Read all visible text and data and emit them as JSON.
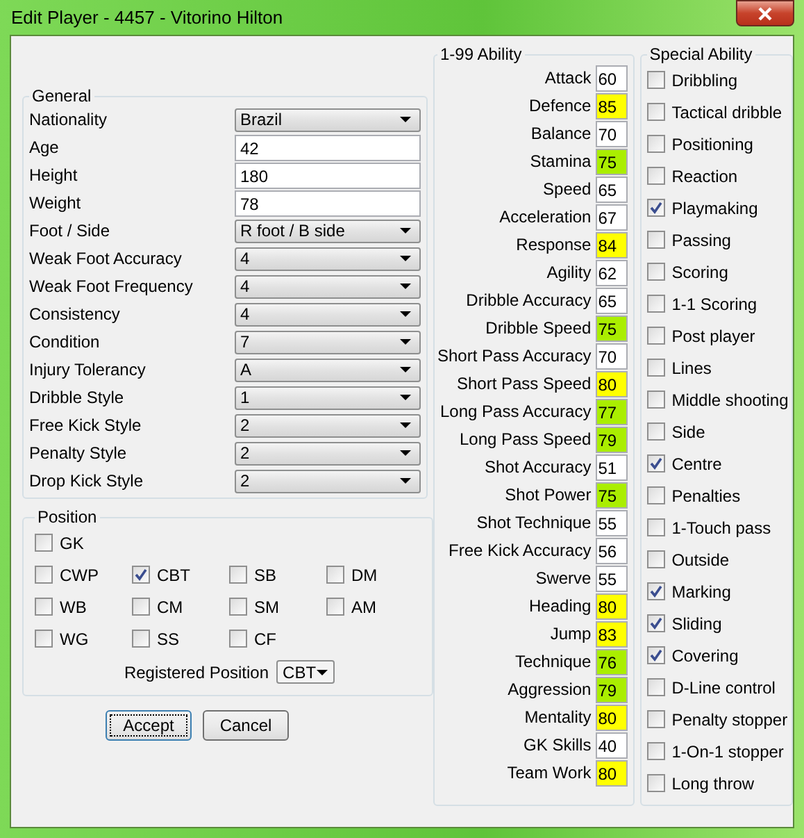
{
  "window": {
    "title": "Edit Player - 4457 - Vitorino Hilton"
  },
  "general": {
    "title": "General",
    "fields": [
      {
        "label": "Nationality",
        "kind": "select",
        "value": "Brazil"
      },
      {
        "label": "Age",
        "kind": "text",
        "value": "42"
      },
      {
        "label": "Height",
        "kind": "text",
        "value": "180"
      },
      {
        "label": "Weight",
        "kind": "text",
        "value": "78"
      },
      {
        "label": "Foot / Side",
        "kind": "select",
        "value": "R foot / B side"
      },
      {
        "label": "Weak Foot Accuracy",
        "kind": "select",
        "value": "4"
      },
      {
        "label": "Weak Foot Frequency",
        "kind": "select",
        "value": "4"
      },
      {
        "label": "Consistency",
        "kind": "select",
        "value": "4"
      },
      {
        "label": "Condition",
        "kind": "select",
        "value": "7"
      },
      {
        "label": "Injury Tolerancy",
        "kind": "select",
        "value": "A"
      },
      {
        "label": "Dribble Style",
        "kind": "select",
        "value": "1"
      },
      {
        "label": "Free Kick Style",
        "kind": "select",
        "value": "2"
      },
      {
        "label": "Penalty Style",
        "kind": "select",
        "value": "2"
      },
      {
        "label": "Drop Kick Style",
        "kind": "select",
        "value": "2"
      }
    ]
  },
  "position": {
    "title": "Position",
    "rows": [
      {
        "items": [
          {
            "label": "GK",
            "checked": false
          }
        ]
      },
      {
        "items": [
          {
            "label": "CWP",
            "checked": false
          },
          {
            "label": "CBT",
            "checked": true
          },
          {
            "label": "SB",
            "checked": false
          },
          {
            "label": "DM",
            "checked": false
          }
        ]
      },
      {
        "items": [
          {
            "label": "WB",
            "checked": false
          },
          {
            "label": "CM",
            "checked": false
          },
          {
            "label": "SM",
            "checked": false
          },
          {
            "label": "AM",
            "checked": false
          }
        ]
      },
      {
        "items": [
          {
            "label": "WG",
            "checked": false
          },
          {
            "label": "SS",
            "checked": false
          },
          {
            "label": "CF",
            "checked": false
          }
        ]
      }
    ],
    "registered_label": "Registered Position",
    "registered_value": "CBT"
  },
  "buttons": [
    {
      "label": "Accept",
      "focused": true
    },
    {
      "label": "Cancel",
      "focused": false
    }
  ],
  "abilities": {
    "title": "1-99 Ability",
    "items": [
      {
        "label": "Attack",
        "value": "60",
        "color": "#ffffff"
      },
      {
        "label": "Defence",
        "value": "85",
        "color": "#ffff00"
      },
      {
        "label": "Balance",
        "value": "70",
        "color": "#ffffff"
      },
      {
        "label": "Stamina",
        "value": "75",
        "color": "#aaee00"
      },
      {
        "label": "Speed",
        "value": "65",
        "color": "#ffffff"
      },
      {
        "label": "Acceleration",
        "value": "67",
        "color": "#ffffff"
      },
      {
        "label": "Response",
        "value": "84",
        "color": "#ffff00"
      },
      {
        "label": "Agility",
        "value": "62",
        "color": "#ffffff"
      },
      {
        "label": "Dribble Accuracy",
        "value": "65",
        "color": "#ffffff"
      },
      {
        "label": "Dribble Speed",
        "value": "75",
        "color": "#aaee00"
      },
      {
        "label": "Short Pass Accuracy",
        "value": "70",
        "color": "#ffffff"
      },
      {
        "label": "Short Pass Speed",
        "value": "80",
        "color": "#ffff00"
      },
      {
        "label": "Long Pass Accuracy",
        "value": "77",
        "color": "#aaee00"
      },
      {
        "label": "Long Pass Speed",
        "value": "79",
        "color": "#aaee00"
      },
      {
        "label": "Shot Accuracy",
        "value": "51",
        "color": "#ffffff"
      },
      {
        "label": "Shot Power",
        "value": "75",
        "color": "#aaee00"
      },
      {
        "label": "Shot Technique",
        "value": "55",
        "color": "#ffffff"
      },
      {
        "label": "Free Kick Accuracy",
        "value": "56",
        "color": "#ffffff"
      },
      {
        "label": "Swerve",
        "value": "55",
        "color": "#ffffff"
      },
      {
        "label": "Heading",
        "value": "80",
        "color": "#ffff00"
      },
      {
        "label": "Jump",
        "value": "83",
        "color": "#ffff00"
      },
      {
        "label": "Technique",
        "value": "76",
        "color": "#aaee00"
      },
      {
        "label": "Aggression",
        "value": "79",
        "color": "#aaee00"
      },
      {
        "label": "Mentality",
        "value": "80",
        "color": "#ffff00"
      },
      {
        "label": "GK Skills",
        "value": "40",
        "color": "#ffffff"
      },
      {
        "label": "Team Work",
        "value": "80",
        "color": "#ffff00"
      }
    ]
  },
  "special": {
    "title": "Special Ability",
    "items": [
      {
        "label": "Dribbling",
        "checked": false
      },
      {
        "label": "Tactical dribble",
        "checked": false
      },
      {
        "label": "Positioning",
        "checked": false
      },
      {
        "label": "Reaction",
        "checked": false
      },
      {
        "label": "Playmaking",
        "checked": true
      },
      {
        "label": "Passing",
        "checked": false
      },
      {
        "label": "Scoring",
        "checked": false
      },
      {
        "label": "1-1 Scoring",
        "checked": false
      },
      {
        "label": "Post player",
        "checked": false
      },
      {
        "label": "Lines",
        "checked": false
      },
      {
        "label": "Middle shooting",
        "checked": false
      },
      {
        "label": "Side",
        "checked": false
      },
      {
        "label": "Centre",
        "checked": true
      },
      {
        "label": "Penalties",
        "checked": false
      },
      {
        "label": "1-Touch pass",
        "checked": false
      },
      {
        "label": "Outside",
        "checked": false
      },
      {
        "label": "Marking",
        "checked": true
      },
      {
        "label": "Sliding",
        "checked": true
      },
      {
        "label": "Covering",
        "checked": true
      },
      {
        "label": "D-Line control",
        "checked": false
      },
      {
        "label": "Penalty stopper",
        "checked": false
      },
      {
        "label": "1-On-1 stopper",
        "checked": false
      },
      {
        "label": "Long throw",
        "checked": false
      }
    ]
  }
}
